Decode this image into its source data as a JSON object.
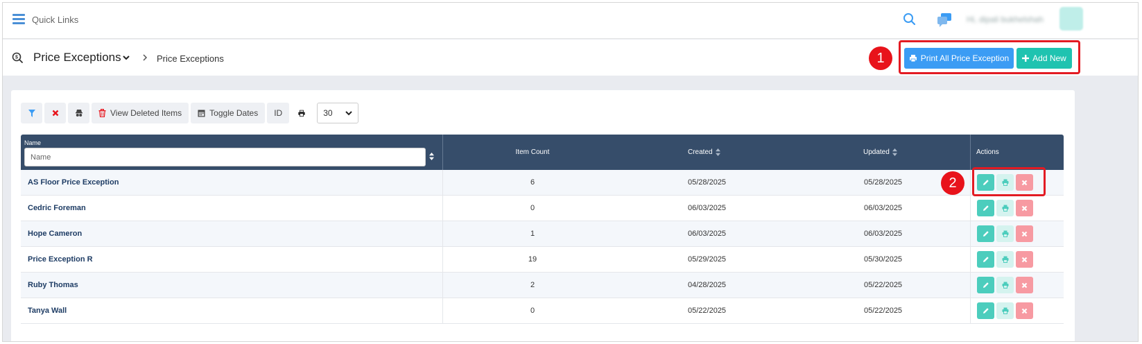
{
  "topbar": {
    "quick_links": "Quick Links",
    "user_name": "Hi, dipali bukhelshah"
  },
  "header": {
    "title": "Price Exceptions",
    "breadcrumb": "Price Exceptions",
    "print_all_label": "Print All Price Exception",
    "add_new_label": "Add New"
  },
  "callouts": [
    "1",
    "2"
  ],
  "toolbar": {
    "view_deleted_label": "View Deleted Items",
    "toggle_dates_label": "Toggle Dates",
    "id_label": "ID",
    "page_size": "30"
  },
  "table": {
    "columns": {
      "name": "Name",
      "item_count": "Item Count",
      "created": "Created",
      "updated": "Updated",
      "actions": "Actions"
    },
    "name_filter_placeholder": "Name",
    "rows": [
      {
        "name": "AS Floor Price Exception",
        "count": "6",
        "created": "05/28/2025",
        "updated": "05/28/2025"
      },
      {
        "name": "Cedric Foreman",
        "count": "0",
        "created": "06/03/2025",
        "updated": "06/03/2025"
      },
      {
        "name": "Hope Cameron",
        "count": "1",
        "created": "06/03/2025",
        "updated": "06/03/2025"
      },
      {
        "name": "Price Exception R",
        "count": "19",
        "created": "05/29/2025",
        "updated": "05/30/2025"
      },
      {
        "name": "Ruby Thomas",
        "count": "2",
        "created": "04/28/2025",
        "updated": "05/22/2025"
      },
      {
        "name": "Tanya Wall",
        "count": "0",
        "created": "05/22/2025",
        "updated": "05/22/2025"
      }
    ]
  },
  "colors": {
    "primary_blue": "#3b9cf4",
    "teal": "#1fc3b0",
    "table_header": "#364d6a",
    "callout_red": "#e8131b"
  },
  "icons": [
    "menu-icon",
    "search-icon",
    "chat-icon",
    "price-tag-icon",
    "chevron-down-icon",
    "chevron-right-icon",
    "print-icon",
    "plus-icon",
    "filter-icon",
    "clear-filter-icon",
    "spy-icon",
    "trash-icon",
    "calendar-icon",
    "sort-icon",
    "edit-icon",
    "delete-icon"
  ]
}
